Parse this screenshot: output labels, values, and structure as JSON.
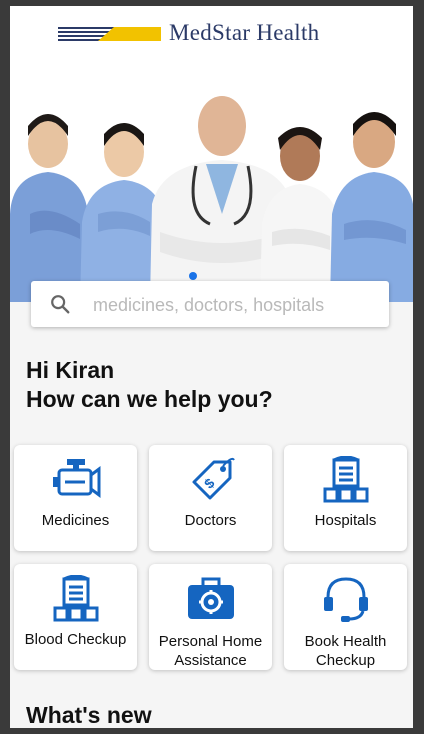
{
  "brand": {
    "name": "MedStar Health",
    "colors": {
      "navy": "#2b3a67",
      "yellow": "#f2c200",
      "accent": "#1a73e8",
      "icon": "#1565c0"
    }
  },
  "hero": {
    "image": "group of five medical staff in scrubs and lab coat",
    "carousel_active_index": 0
  },
  "search": {
    "placeholder": "medicines, doctors, hospitals",
    "value": ""
  },
  "greeting": {
    "line1": "Hi Kiran",
    "line2": "How can we help you?"
  },
  "services": [
    {
      "label": "Medicines",
      "icon": "engine-icon"
    },
    {
      "label": "Doctors",
      "icon": "price-tag-icon"
    },
    {
      "label": "Hospitals",
      "icon": "hospital-building-icon"
    },
    {
      "label": "Blood Checkup",
      "icon": "hospital-building-icon"
    },
    {
      "label_line1": "Personal Home",
      "label_line2": "Assistance",
      "icon": "medical-kit-icon"
    },
    {
      "label_line1": "Book Health",
      "label_line2": "Checkup",
      "icon": "headset-icon"
    }
  ],
  "section": {
    "whats_new": "What's new"
  }
}
